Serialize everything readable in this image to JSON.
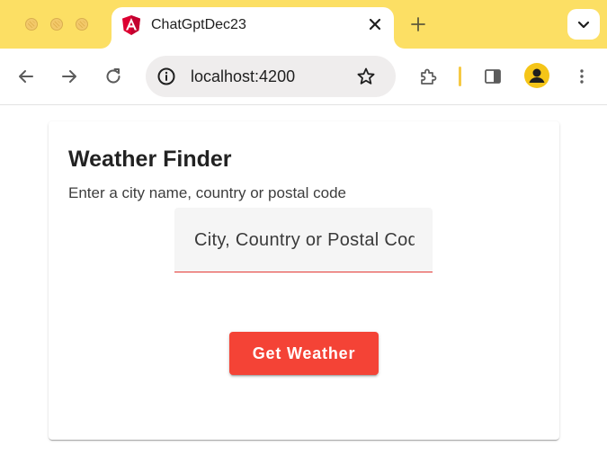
{
  "browser": {
    "tab": {
      "title": "ChatGptDec23",
      "favicon": "angular-icon",
      "close_icon": "close-icon"
    },
    "new_tab_icon": "plus-icon",
    "tab_search_icon": "chevron-down-icon",
    "toolbar": {
      "back_icon": "arrow-left-icon",
      "forward_icon": "arrow-right-icon",
      "reload_icon": "reload-icon",
      "address": "localhost:4200",
      "site_info_icon": "info-icon",
      "bookmark_icon": "star-icon",
      "extensions_icon": "puzzle-icon",
      "side_panel_icon": "side-panel-icon",
      "profile_icon": "avatar",
      "menu_icon": "kebab-menu-icon"
    },
    "colors": {
      "frame": "#fcdf64",
      "accent": "#f44336"
    }
  },
  "app": {
    "title": "Weather Finder",
    "subtitle": "Enter a city name, country or postal code",
    "search": {
      "placeholder": "City, Country or Postal Code",
      "value": ""
    },
    "button_label": "Get Weather"
  }
}
